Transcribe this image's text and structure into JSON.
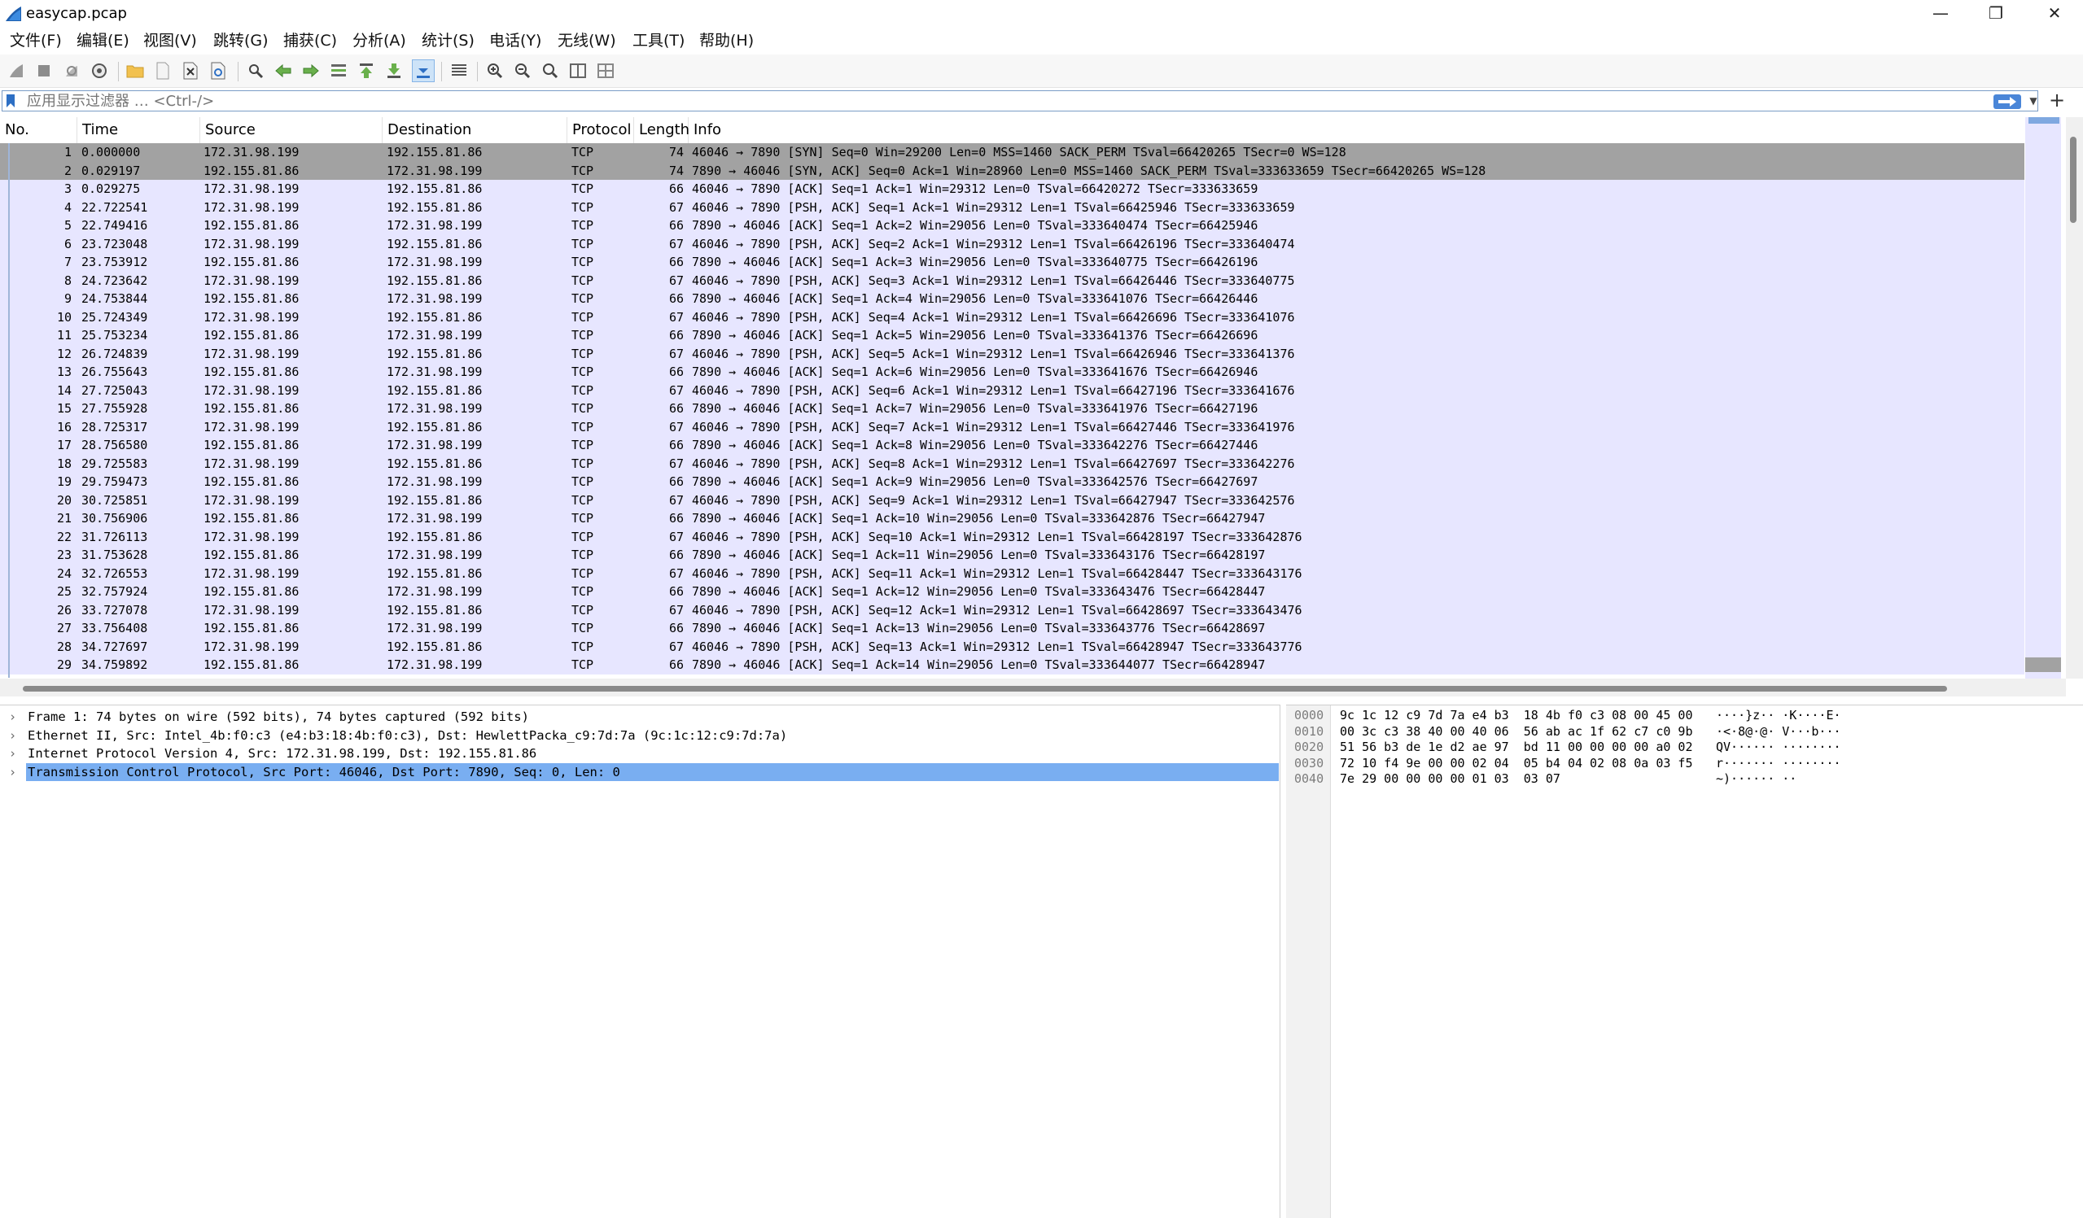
{
  "window": {
    "title": "easycap.pcap",
    "controls": {
      "minimize": "—",
      "restore": "❐",
      "close": "✕"
    }
  },
  "menu": [
    "文件(F)",
    "编辑(E)",
    "视图(V)",
    "跳转(G)",
    "捕获(C)",
    "分析(A)",
    "统计(S)",
    "电话(Y)",
    "无线(W)",
    "工具(T)",
    "帮助(H)"
  ],
  "toolbar": {
    "icons": [
      "shark-fin-start-icon",
      "stop-square-icon",
      "restart-fin-icon",
      "capture-options-gear-icon",
      "open-folder-icon",
      "save-file-icon",
      "close-file-icon",
      "reload-file-icon",
      "find-packet-icon",
      "go-back-arrow-icon",
      "go-forward-arrow-icon",
      "go-to-packet-icon",
      "go-first-packet-icon",
      "go-last-packet-icon",
      "autoscroll-icon",
      "colorize-icon",
      "zoom-in-icon",
      "zoom-out-icon",
      "normal-size-icon",
      "resize-columns-icon",
      "split-panes-icon"
    ]
  },
  "filter": {
    "placeholder": "应用显示过滤器 … <Ctrl-/>",
    "value": ""
  },
  "packet_list": {
    "columns": [
      "No.",
      "Time",
      "Source",
      "Destination",
      "Protocol",
      "Length",
      "Info"
    ],
    "selected_index": 0,
    "rows": [
      {
        "no": "1",
        "time": "0.000000",
        "src": "172.31.98.199",
        "dst": "192.155.81.86",
        "proto": "TCP",
        "len": "74",
        "info": "46046 → 7890 [SYN] Seq=0 Win=29200 Len=0 MSS=1460 SACK_PERM TSval=66420265 TSecr=0 WS=128"
      },
      {
        "no": "2",
        "time": "0.029197",
        "src": "192.155.81.86",
        "dst": "172.31.98.199",
        "proto": "TCP",
        "len": "74",
        "info": "7890 → 46046 [SYN, ACK] Seq=0 Ack=1 Win=28960 Len=0 MSS=1460 SACK_PERM TSval=333633659 TSecr=66420265 WS=128"
      },
      {
        "no": "3",
        "time": "0.029275",
        "src": "172.31.98.199",
        "dst": "192.155.81.86",
        "proto": "TCP",
        "len": "66",
        "info": "46046 → 7890 [ACK] Seq=1 Ack=1 Win=29312 Len=0 TSval=66420272 TSecr=333633659"
      },
      {
        "no": "4",
        "time": "22.722541",
        "src": "172.31.98.199",
        "dst": "192.155.81.86",
        "proto": "TCP",
        "len": "67",
        "info": "46046 → 7890 [PSH, ACK] Seq=1 Ack=1 Win=29312 Len=1 TSval=66425946 TSecr=333633659"
      },
      {
        "no": "5",
        "time": "22.749416",
        "src": "192.155.81.86",
        "dst": "172.31.98.199",
        "proto": "TCP",
        "len": "66",
        "info": "7890 → 46046 [ACK] Seq=1 Ack=2 Win=29056 Len=0 TSval=333640474 TSecr=66425946"
      },
      {
        "no": "6",
        "time": "23.723048",
        "src": "172.31.98.199",
        "dst": "192.155.81.86",
        "proto": "TCP",
        "len": "67",
        "info": "46046 → 7890 [PSH, ACK] Seq=2 Ack=1 Win=29312 Len=1 TSval=66426196 TSecr=333640474"
      },
      {
        "no": "7",
        "time": "23.753912",
        "src": "192.155.81.86",
        "dst": "172.31.98.199",
        "proto": "TCP",
        "len": "66",
        "info": "7890 → 46046 [ACK] Seq=1 Ack=3 Win=29056 Len=0 TSval=333640775 TSecr=66426196"
      },
      {
        "no": "8",
        "time": "24.723642",
        "src": "172.31.98.199",
        "dst": "192.155.81.86",
        "proto": "TCP",
        "len": "67",
        "info": "46046 → 7890 [PSH, ACK] Seq=3 Ack=1 Win=29312 Len=1 TSval=66426446 TSecr=333640775"
      },
      {
        "no": "9",
        "time": "24.753844",
        "src": "192.155.81.86",
        "dst": "172.31.98.199",
        "proto": "TCP",
        "len": "66",
        "info": "7890 → 46046 [ACK] Seq=1 Ack=4 Win=29056 Len=0 TSval=333641076 TSecr=66426446"
      },
      {
        "no": "10",
        "time": "25.724349",
        "src": "172.31.98.199",
        "dst": "192.155.81.86",
        "proto": "TCP",
        "len": "67",
        "info": "46046 → 7890 [PSH, ACK] Seq=4 Ack=1 Win=29312 Len=1 TSval=66426696 TSecr=333641076"
      },
      {
        "no": "11",
        "time": "25.753234",
        "src": "192.155.81.86",
        "dst": "172.31.98.199",
        "proto": "TCP",
        "len": "66",
        "info": "7890 → 46046 [ACK] Seq=1 Ack=5 Win=29056 Len=0 TSval=333641376 TSecr=66426696"
      },
      {
        "no": "12",
        "time": "26.724839",
        "src": "172.31.98.199",
        "dst": "192.155.81.86",
        "proto": "TCP",
        "len": "67",
        "info": "46046 → 7890 [PSH, ACK] Seq=5 Ack=1 Win=29312 Len=1 TSval=66426946 TSecr=333641376"
      },
      {
        "no": "13",
        "time": "26.755643",
        "src": "192.155.81.86",
        "dst": "172.31.98.199",
        "proto": "TCP",
        "len": "66",
        "info": "7890 → 46046 [ACK] Seq=1 Ack=6 Win=29056 Len=0 TSval=333641676 TSecr=66426946"
      },
      {
        "no": "14",
        "time": "27.725043",
        "src": "172.31.98.199",
        "dst": "192.155.81.86",
        "proto": "TCP",
        "len": "67",
        "info": "46046 → 7890 [PSH, ACK] Seq=6 Ack=1 Win=29312 Len=1 TSval=66427196 TSecr=333641676"
      },
      {
        "no": "15",
        "time": "27.755928",
        "src": "192.155.81.86",
        "dst": "172.31.98.199",
        "proto": "TCP",
        "len": "66",
        "info": "7890 → 46046 [ACK] Seq=1 Ack=7 Win=29056 Len=0 TSval=333641976 TSecr=66427196"
      },
      {
        "no": "16",
        "time": "28.725317",
        "src": "172.31.98.199",
        "dst": "192.155.81.86",
        "proto": "TCP",
        "len": "67",
        "info": "46046 → 7890 [PSH, ACK] Seq=7 Ack=1 Win=29312 Len=1 TSval=66427446 TSecr=333641976"
      },
      {
        "no": "17",
        "time": "28.756580",
        "src": "192.155.81.86",
        "dst": "172.31.98.199",
        "proto": "TCP",
        "len": "66",
        "info": "7890 → 46046 [ACK] Seq=1 Ack=8 Win=29056 Len=0 TSval=333642276 TSecr=66427446"
      },
      {
        "no": "18",
        "time": "29.725583",
        "src": "172.31.98.199",
        "dst": "192.155.81.86",
        "proto": "TCP",
        "len": "67",
        "info": "46046 → 7890 [PSH, ACK] Seq=8 Ack=1 Win=29312 Len=1 TSval=66427697 TSecr=333642276"
      },
      {
        "no": "19",
        "time": "29.759473",
        "src": "192.155.81.86",
        "dst": "172.31.98.199",
        "proto": "TCP",
        "len": "66",
        "info": "7890 → 46046 [ACK] Seq=1 Ack=9 Win=29056 Len=0 TSval=333642576 TSecr=66427697"
      },
      {
        "no": "20",
        "time": "30.725851",
        "src": "172.31.98.199",
        "dst": "192.155.81.86",
        "proto": "TCP",
        "len": "67",
        "info": "46046 → 7890 [PSH, ACK] Seq=9 Ack=1 Win=29312 Len=1 TSval=66427947 TSecr=333642576"
      },
      {
        "no": "21",
        "time": "30.756906",
        "src": "192.155.81.86",
        "dst": "172.31.98.199",
        "proto": "TCP",
        "len": "66",
        "info": "7890 → 46046 [ACK] Seq=1 Ack=10 Win=29056 Len=0 TSval=333642876 TSecr=66427947"
      },
      {
        "no": "22",
        "time": "31.726113",
        "src": "172.31.98.199",
        "dst": "192.155.81.86",
        "proto": "TCP",
        "len": "67",
        "info": "46046 → 7890 [PSH, ACK] Seq=10 Ack=1 Win=29312 Len=1 TSval=66428197 TSecr=333642876"
      },
      {
        "no": "23",
        "time": "31.753628",
        "src": "192.155.81.86",
        "dst": "172.31.98.199",
        "proto": "TCP",
        "len": "66",
        "info": "7890 → 46046 [ACK] Seq=1 Ack=11 Win=29056 Len=0 TSval=333643176 TSecr=66428197"
      },
      {
        "no": "24",
        "time": "32.726553",
        "src": "172.31.98.199",
        "dst": "192.155.81.86",
        "proto": "TCP",
        "len": "67",
        "info": "46046 → 7890 [PSH, ACK] Seq=11 Ack=1 Win=29312 Len=1 TSval=66428447 TSecr=333643176"
      },
      {
        "no": "25",
        "time": "32.757924",
        "src": "192.155.81.86",
        "dst": "172.31.98.199",
        "proto": "TCP",
        "len": "66",
        "info": "7890 → 46046 [ACK] Seq=1 Ack=12 Win=29056 Len=0 TSval=333643476 TSecr=66428447"
      },
      {
        "no": "26",
        "time": "33.727078",
        "src": "172.31.98.199",
        "dst": "192.155.81.86",
        "proto": "TCP",
        "len": "67",
        "info": "46046 → 7890 [PSH, ACK] Seq=12 Ack=1 Win=29312 Len=1 TSval=66428697 TSecr=333643476"
      },
      {
        "no": "27",
        "time": "33.756408",
        "src": "192.155.81.86",
        "dst": "172.31.98.199",
        "proto": "TCP",
        "len": "66",
        "info": "7890 → 46046 [ACK] Seq=1 Ack=13 Win=29056 Len=0 TSval=333643776 TSecr=66428697"
      },
      {
        "no": "28",
        "time": "34.727697",
        "src": "172.31.98.199",
        "dst": "192.155.81.86",
        "proto": "TCP",
        "len": "67",
        "info": "46046 → 7890 [PSH, ACK] Seq=13 Ack=1 Win=29312 Len=1 TSval=66428947 TSecr=333643776"
      },
      {
        "no": "29",
        "time": "34.759892",
        "src": "192.155.81.86",
        "dst": "172.31.98.199",
        "proto": "TCP",
        "len": "66",
        "info": "7890 → 46046 [ACK] Seq=1 Ack=14 Win=29056 Len=0 TSval=333644077 TSecr=66428947"
      }
    ]
  },
  "details": [
    {
      "text": "Frame 1: 74 bytes on wire (592 bits), 74 bytes captured (592 bits)",
      "selected": false
    },
    {
      "text": "Ethernet II, Src: Intel_4b:f0:c3 (e4:b3:18:4b:f0:c3), Dst: HewlettPacka_c9:7d:7a (9c:1c:12:c9:7d:7a)",
      "selected": false
    },
    {
      "text": "Internet Protocol Version 4, Src: 172.31.98.199, Dst: 192.155.81.86",
      "selected": false
    },
    {
      "text": "Transmission Control Protocol, Src Port: 46046, Dst Port: 7890, Seq: 0, Len: 0",
      "selected": true
    }
  ],
  "hex": [
    {
      "offset": "0000",
      "bytes": "9c 1c 12 c9 7d 7a e4 b3  18 4b f0 c3 08 00 45 00",
      "ascii": "····}z·· ·K····E·"
    },
    {
      "offset": "0010",
      "bytes": "00 3c c3 38 40 00 40 06  56 ab ac 1f 62 c7 c0 9b",
      "ascii": "·<·8@·@· V···b···"
    },
    {
      "offset": "0020",
      "bytes": "51 56 b3 de 1e d2 ae 97  bd 11 00 00 00 00 a0 02",
      "ascii": "QV······ ········"
    },
    {
      "offset": "0030",
      "bytes": "72 10 f4 9e 00 00 02 04  05 b4 04 02 08 0a 03 f5",
      "ascii": "r······· ········"
    },
    {
      "offset": "0040",
      "bytes": "7e 29 00 00 00 00 01 03  03 07",
      "ascii": "~)······ ··"
    }
  ],
  "colors": {
    "row_bg": "#e7e6ff",
    "row_selected": "#a2a2a2",
    "detail_selected": "#79aef1",
    "apply_button": "#4a86d8"
  }
}
